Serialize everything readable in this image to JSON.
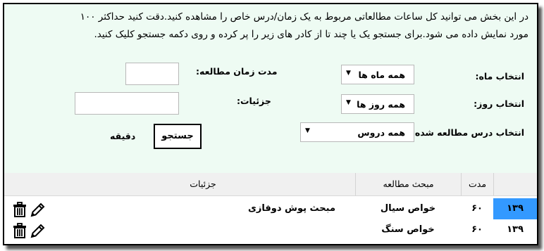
{
  "intro": {
    "line1": "در این بخش می توانید کل ساعات مطالعاتی مربوط به یک زمان/درس خاص را مشاهده کنید.دقت کنید حداکثر ۱۰۰",
    "line2": "مورد نمایش داده می شود.برای جستجو یک یا چند تا از کادر های زیر را پر کرده و روی دکمه جستجو کلیک کنید."
  },
  "filters": {
    "month_label": "انتخاب ماه:",
    "month_value": "همه ماه ها",
    "day_label": "انتخاب روز:",
    "day_value": "همه روز ها",
    "course_label": "انتخاب درس مطالعه شده:",
    "course_value": "همه دروس",
    "duration_label": "مدت زمان مطالعه:",
    "duration_value": "",
    "details_label": "جزئیات:",
    "details_value": "",
    "search_button": "جستجو",
    "minute_unit": "دقیقه"
  },
  "table": {
    "headers": [
      "مدت",
      "مبحث مطالعه",
      "جزئیات"
    ],
    "rows": [
      {
        "id": "۱۳۹",
        "duration": "۶۰",
        "topic": "خواص سیال",
        "details": "مبحث پوش دوفازی",
        "selected": true
      },
      {
        "id": "۱۳۹",
        "duration": "۶۰",
        "topic": "خواص سنگ",
        "details": "",
        "selected": false
      }
    ]
  },
  "colors": {
    "panel_bg": "#eefbf3",
    "selected_cell": "#3399ff"
  },
  "icons": [
    "edit-icon",
    "trash-icon"
  ]
}
